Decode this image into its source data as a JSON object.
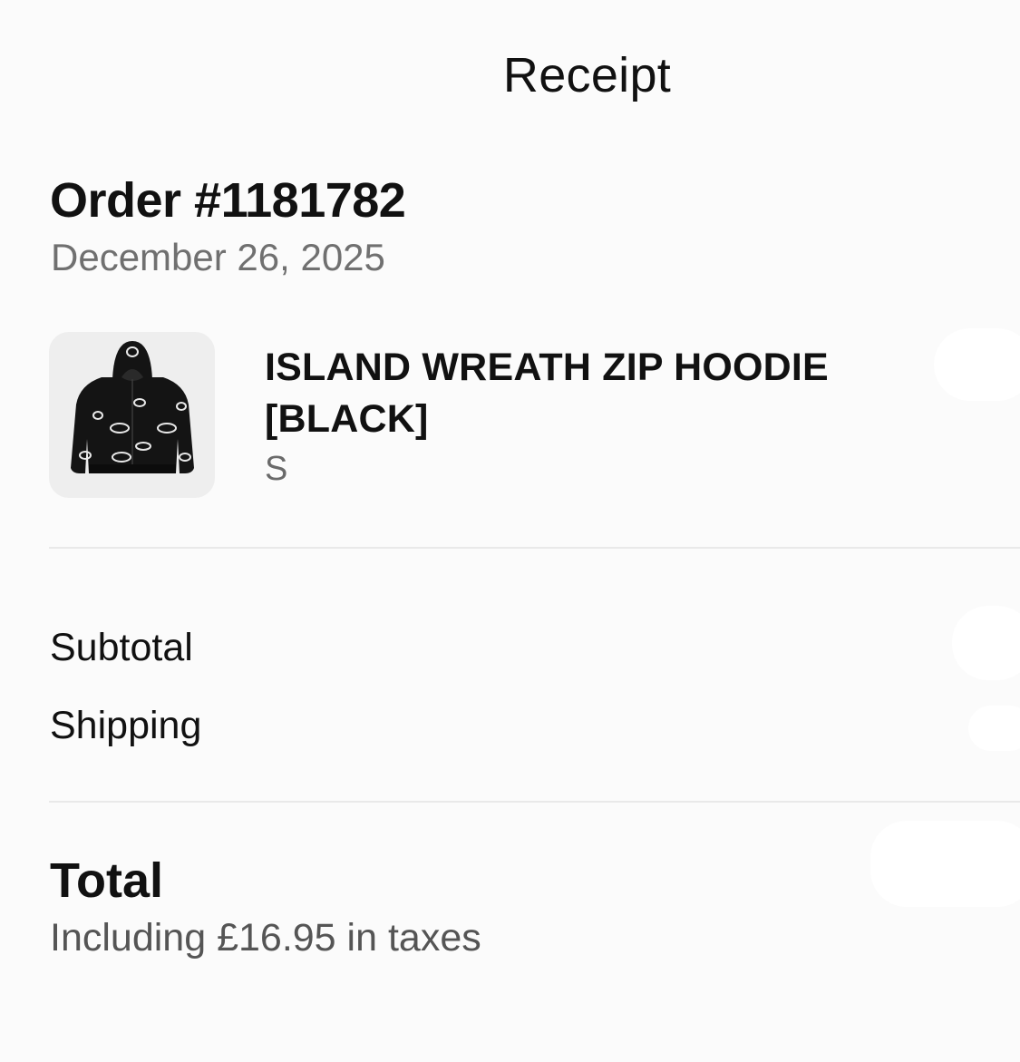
{
  "header": {
    "title": "Receipt"
  },
  "order": {
    "number_label": "Order #1181782",
    "date": "December 26, 2025"
  },
  "item": {
    "thumbnail_icon": "hoodie-thumbnail",
    "name": "ISLAND WREATH ZIP HOODIE [BLACK]",
    "size": "S"
  },
  "summary": {
    "subtotal_label": "Subtotal",
    "shipping_label": "Shipping"
  },
  "total": {
    "label": "Total",
    "tax_note": "Including £16.95 in taxes"
  },
  "colors": {
    "background": "#fbfbfb",
    "text_primary": "#111111",
    "text_secondary": "#707070",
    "divider": "#e9e9e9",
    "thumb_bg": "#eeeeee"
  }
}
